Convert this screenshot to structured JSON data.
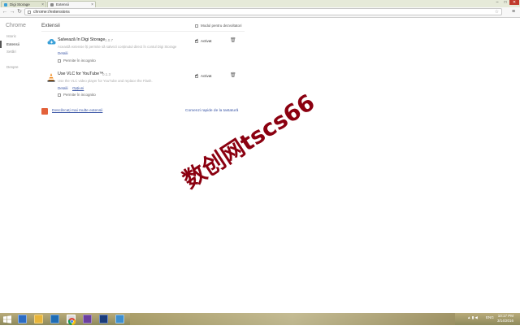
{
  "tabs": [
    {
      "label": "Digi Storage",
      "fav_color": "#3aa0d8"
    },
    {
      "label": "Extensii",
      "fav_color": "#888888"
    }
  ],
  "window_controls": {
    "minimize": "–",
    "maximize": "□",
    "close": "✕"
  },
  "toolbar": {
    "back": "←",
    "forward": "→",
    "reload": "↻",
    "url": "chrome://extensions",
    "star": "☆",
    "menu": "≡"
  },
  "sidebar": {
    "title": "Chrome",
    "items": [
      {
        "label": "Istoric"
      },
      {
        "label": "Extensii"
      },
      {
        "label": "Setări"
      },
      {
        "label": "Despre"
      }
    ]
  },
  "main": {
    "title": "Extensii",
    "developer_mode_label": "Modul pentru dezvoltatori",
    "developer_mode_checked": false
  },
  "extensions": [
    {
      "name": "Salvează în Digi Storage",
      "version": "1.0.7",
      "description": "Această extensie îți permite să salvezi conținutul direct în contul Digi Storage",
      "details_link": "Detalii",
      "options_link": "",
      "incognito_label": "Permite în incognito",
      "enabled_label": "Activat",
      "enabled": true
    },
    {
      "name": "Use VLC for YouTube™",
      "version": "0.1.3",
      "description": "Use the VLC video player for YouTube and replace the Flash.",
      "details_link": "Detalii",
      "options_link": "Opțiuni",
      "incognito_label": "Permite în incognito",
      "enabled_label": "Activat",
      "enabled": true
    }
  ],
  "footer": {
    "get_more": "Descărcați mai multe extensii",
    "shortcuts": "Comenzi rapide de la tastatură"
  },
  "watermark": "数创网tscs66",
  "taskbar": {
    "tray_language": "ENG",
    "time": "10:17 PM",
    "date": "3/14/2016"
  }
}
